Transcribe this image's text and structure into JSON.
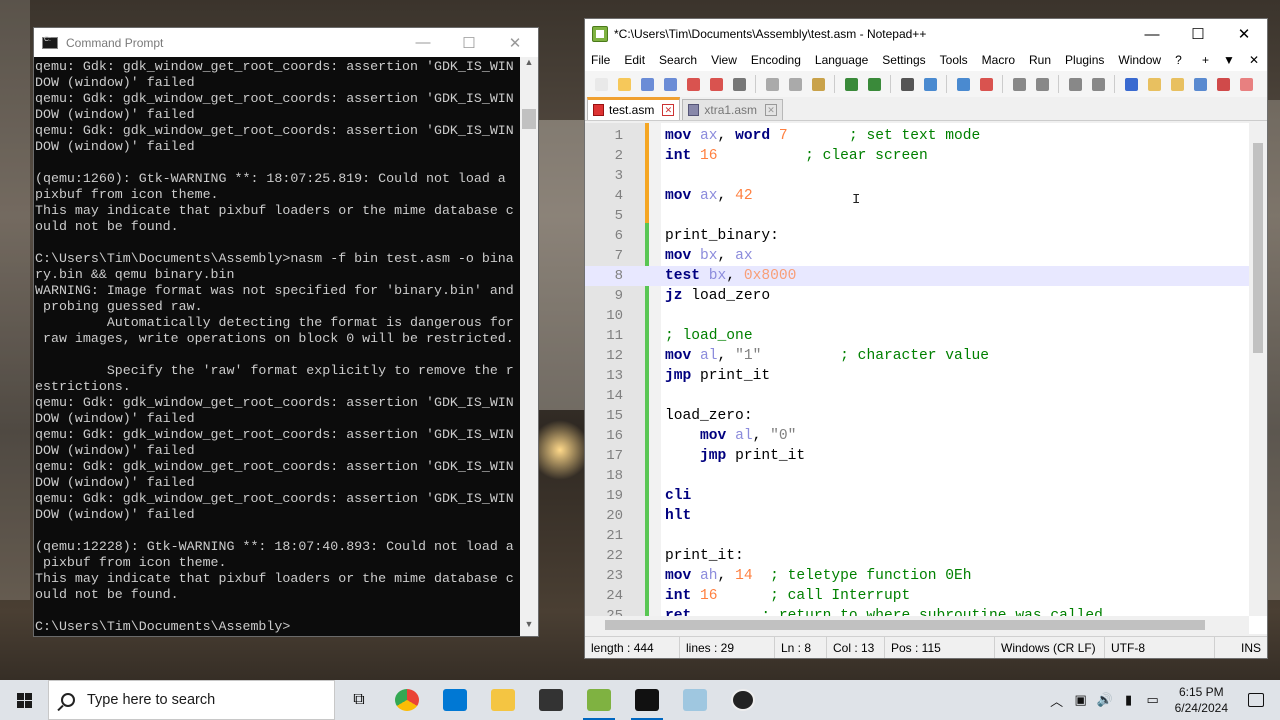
{
  "cmd": {
    "title": "Command Prompt",
    "lines": [
      "qemu: Gdk: gdk_window_get_root_coords: assertion 'GDK_IS_WIN",
      "DOW (window)' failed",
      "qemu: Gdk: gdk_window_get_root_coords: assertion 'GDK_IS_WIN",
      "DOW (window)' failed",
      "qemu: Gdk: gdk_window_get_root_coords: assertion 'GDK_IS_WIN",
      "DOW (window)' failed",
      "",
      "(qemu:1260): Gtk-WARNING **: 18:07:25.819: Could not load a",
      "pixbuf from icon theme.",
      "This may indicate that pixbuf loaders or the mime database c",
      "ould not be found.",
      "",
      "C:\\Users\\Tim\\Documents\\Assembly>nasm -f bin test.asm -o bina",
      "ry.bin && qemu binary.bin",
      "WARNING: Image format was not specified for 'binary.bin' and",
      " probing guessed raw.",
      "         Automatically detecting the format is dangerous for",
      " raw images, write operations on block 0 will be restricted.",
      "",
      "         Specify the 'raw' format explicitly to remove the r",
      "estrictions.",
      "qemu: Gdk: gdk_window_get_root_coords: assertion 'GDK_IS_WIN",
      "DOW (window)' failed",
      "qemu: Gdk: gdk_window_get_root_coords: assertion 'GDK_IS_WIN",
      "DOW (window)' failed",
      "qemu: Gdk: gdk_window_get_root_coords: assertion 'GDK_IS_WIN",
      "DOW (window)' failed",
      "qemu: Gdk: gdk_window_get_root_coords: assertion 'GDK_IS_WIN",
      "DOW (window)' failed",
      "",
      "(qemu:12228): Gtk-WARNING **: 18:07:40.893: Could not load a",
      " pixbuf from icon theme.",
      "This may indicate that pixbuf loaders or the mime database c",
      "ould not be found.",
      "",
      "C:\\Users\\Tim\\Documents\\Assembly>"
    ]
  },
  "npp": {
    "title": "*C:\\Users\\Tim\\Documents\\Assembly\\test.asm - Notepad++",
    "menu": [
      "File",
      "Edit",
      "Search",
      "View",
      "Encoding",
      "Language",
      "Settings",
      "Tools",
      "Macro",
      "Run",
      "Plugins",
      "Window",
      "?"
    ],
    "menu_right": [
      "+",
      "▼",
      "✕"
    ],
    "tabs": [
      {
        "label": "test.asm",
        "active": true
      },
      {
        "label": "xtra1.asm",
        "active": false
      }
    ],
    "code": [
      {
        "n": "1",
        "t": [
          [
            "kw",
            "mov "
          ],
          [
            "reg",
            "ax"
          ],
          [
            "",
            ","
          ],
          [
            "kw",
            " word "
          ],
          [
            "num",
            "7"
          ],
          [
            "",
            "       "
          ],
          [
            "cmt",
            "; set text mode"
          ]
        ]
      },
      {
        "n": "2",
        "t": [
          [
            "kw",
            "int "
          ],
          [
            "num",
            "16"
          ],
          [
            "",
            "          "
          ],
          [
            "cmt",
            "; clear screen"
          ]
        ]
      },
      {
        "n": "3",
        "t": []
      },
      {
        "n": "4",
        "t": [
          [
            "kw",
            "mov "
          ],
          [
            "reg",
            "ax"
          ],
          [
            "",
            ", "
          ],
          [
            "num",
            "42"
          ]
        ]
      },
      {
        "n": "5",
        "t": []
      },
      {
        "n": "6",
        "t": [
          [
            "",
            "print_binary:"
          ]
        ]
      },
      {
        "n": "7",
        "t": [
          [
            "kw",
            "mov "
          ],
          [
            "reg",
            "bx"
          ],
          [
            "",
            ", "
          ],
          [
            "reg",
            "ax"
          ]
        ]
      },
      {
        "n": "8",
        "t": [
          [
            "kw",
            "test "
          ],
          [
            "reg",
            "bx"
          ],
          [
            "",
            ", "
          ],
          [
            "hex",
            "0x8000"
          ]
        ]
      },
      {
        "n": "9",
        "t": [
          [
            "kw",
            "jz "
          ],
          [
            "",
            "load_zero"
          ]
        ]
      },
      {
        "n": "10",
        "t": []
      },
      {
        "n": "11",
        "t": [
          [
            "cmt",
            "; load_one"
          ]
        ]
      },
      {
        "n": "12",
        "t": [
          [
            "kw",
            "mov "
          ],
          [
            "reg",
            "al"
          ],
          [
            "",
            ", "
          ],
          [
            "str",
            "\"1\""
          ],
          [
            "",
            "         "
          ],
          [
            "cmt",
            "; character value"
          ]
        ]
      },
      {
        "n": "13",
        "t": [
          [
            "kw",
            "jmp "
          ],
          [
            "",
            "print_it"
          ]
        ]
      },
      {
        "n": "14",
        "t": []
      },
      {
        "n": "15",
        "t": [
          [
            "",
            "load_zero:"
          ]
        ]
      },
      {
        "n": "16",
        "t": [
          [
            "",
            "    "
          ],
          [
            "kw",
            "mov "
          ],
          [
            "reg",
            "al"
          ],
          [
            "",
            ", "
          ],
          [
            "str",
            "\"0\""
          ]
        ]
      },
      {
        "n": "17",
        "t": [
          [
            "",
            "    "
          ],
          [
            "kw",
            "jmp "
          ],
          [
            "",
            "print_it"
          ]
        ]
      },
      {
        "n": "18",
        "t": []
      },
      {
        "n": "19",
        "t": [
          [
            "kw",
            "cli"
          ]
        ]
      },
      {
        "n": "20",
        "t": [
          [
            "kw",
            "hlt"
          ]
        ]
      },
      {
        "n": "21",
        "t": []
      },
      {
        "n": "22",
        "t": [
          [
            "",
            "print_it:"
          ]
        ]
      },
      {
        "n": "23",
        "t": [
          [
            "kw",
            "mov "
          ],
          [
            "reg",
            "ah"
          ],
          [
            "",
            ", "
          ],
          [
            "num",
            "14"
          ],
          [
            "",
            "  "
          ],
          [
            "cmt",
            "; teletype function 0Eh"
          ]
        ]
      },
      {
        "n": "24",
        "t": [
          [
            "kw",
            "int "
          ],
          [
            "num",
            "16"
          ],
          [
            "",
            "      "
          ],
          [
            "cmt",
            "; call Interrupt"
          ]
        ]
      },
      {
        "n": "25",
        "t": [
          [
            "kw",
            "ret"
          ],
          [
            "",
            "        "
          ],
          [
            "cmt",
            "; return to where subroutine was called"
          ]
        ]
      }
    ],
    "current_line": 8,
    "status": {
      "length": "length : 444",
      "lines": "lines : 29",
      "ln": "Ln : 8",
      "col": "Col : 13",
      "pos": "Pos : 115",
      "eol": "Windows (CR LF)",
      "encoding": "UTF-8",
      "mode": "INS"
    }
  },
  "taskbar": {
    "search_placeholder": "Type here to search",
    "time": "6:15 PM",
    "date": "6/24/2024"
  }
}
